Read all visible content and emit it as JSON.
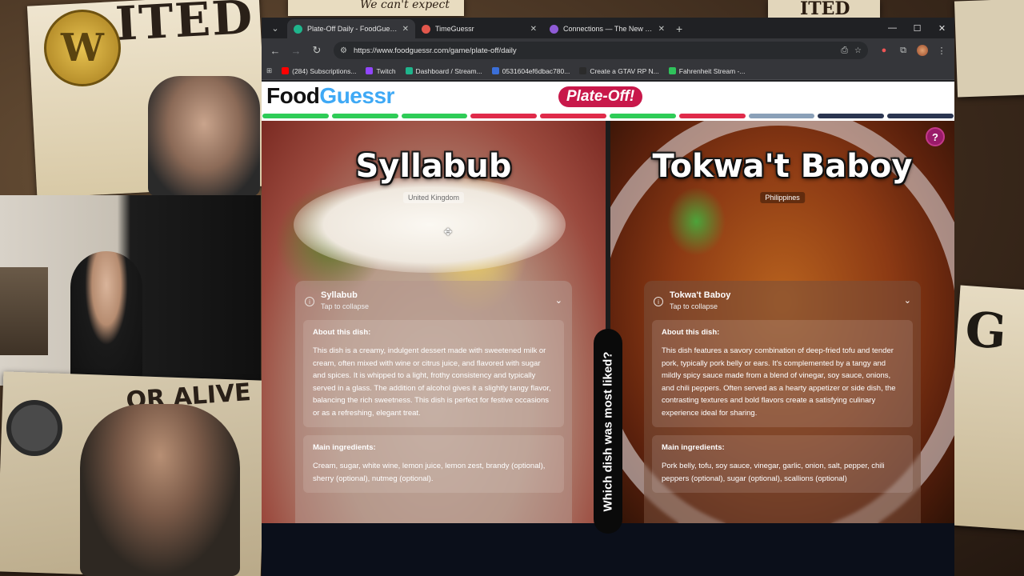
{
  "stream": {
    "poster_top_text": "We can't expect",
    "poster_a_text": "ITED",
    "poster_b_text": "OR ALIVE",
    "poster_c_text": "G",
    "poster_top2_text": "ITED",
    "badge_letter": "W"
  },
  "browser": {
    "tabs": [
      {
        "title": "Plate-Off Daily - FoodGuessr | F",
        "active": true,
        "color": "#1fb58c"
      },
      {
        "title": "TimeGuessr",
        "active": false,
        "color": "#e2574c"
      },
      {
        "title": "Connections — The New York T",
        "active": false,
        "color": "#8f5bd6"
      }
    ],
    "url": "https://www.foodguessr.com/game/plate-off/daily",
    "bookmarks": [
      {
        "label": "(284) Subscriptions...",
        "color": "#ff0000"
      },
      {
        "label": "Twitch",
        "color": "#9146ff"
      },
      {
        "label": "Dashboard / Stream...",
        "color": "#1fb58c"
      },
      {
        "label": "0531604ef6dbac780...",
        "color": "#3b6fd8"
      },
      {
        "label": "Create a GTAV RP N...",
        "color": "#2b2b2b"
      },
      {
        "label": "Fahrenheit Stream -...",
        "color": "#2fc25b"
      }
    ]
  },
  "site": {
    "logo_food": "Food",
    "logo_guessr": "Guessr",
    "mode": "Plate-Off!",
    "progress": [
      "#2ecc57",
      "#2ecc57",
      "#2ecc57",
      "#e02a4a",
      "#e02a4a",
      "#2ecc57",
      "#e02a4a",
      "#8aa0b8",
      "#2a3550",
      "#2a3550"
    ],
    "question": "Which dish was most liked?",
    "help": "?"
  },
  "left": {
    "title": "Syllabub",
    "country": "United Kingdom",
    "name": "Syllabub",
    "collapse": "Tap to collapse",
    "about_heading": "About this dish:",
    "about": "This dish is a creamy, indulgent dessert made with sweetened milk or cream, often mixed with wine or citrus juice, and flavored with sugar and spices. It is whipped to a light, frothy consistency and typically served in a glass. The addition of alcohol gives it a slightly tangy flavor, balancing the rich sweetness. This dish is perfect for festive occasions or as a refreshing, elegant treat.",
    "ing_heading": "Main ingredients:",
    "ingredients": "Cream, sugar, white wine, lemon juice, lemon zest, brandy (optional), sherry (optional), nutmeg (optional)."
  },
  "right": {
    "title": "Tokwa't Baboy",
    "country": "Philippines",
    "name": "Tokwa't Baboy",
    "collapse": "Tap to collapse",
    "about_heading": "About this dish:",
    "about": "This dish features a savory combination of deep-fried tofu and tender pork, typically pork belly or ears. It's complemented by a tangy and mildly spicy sauce made from a blend of vinegar, soy sauce, onions, and chili peppers. Often served as a hearty appetizer or side dish, the contrasting textures and bold flavors create a satisfying culinary experience ideal for sharing.",
    "ing_heading": "Main ingredients:",
    "ingredients": "Pork belly, tofu, soy sauce, vinegar, garlic, onion, salt, pepper, chili peppers (optional), sugar (optional), scallions (optional)"
  }
}
